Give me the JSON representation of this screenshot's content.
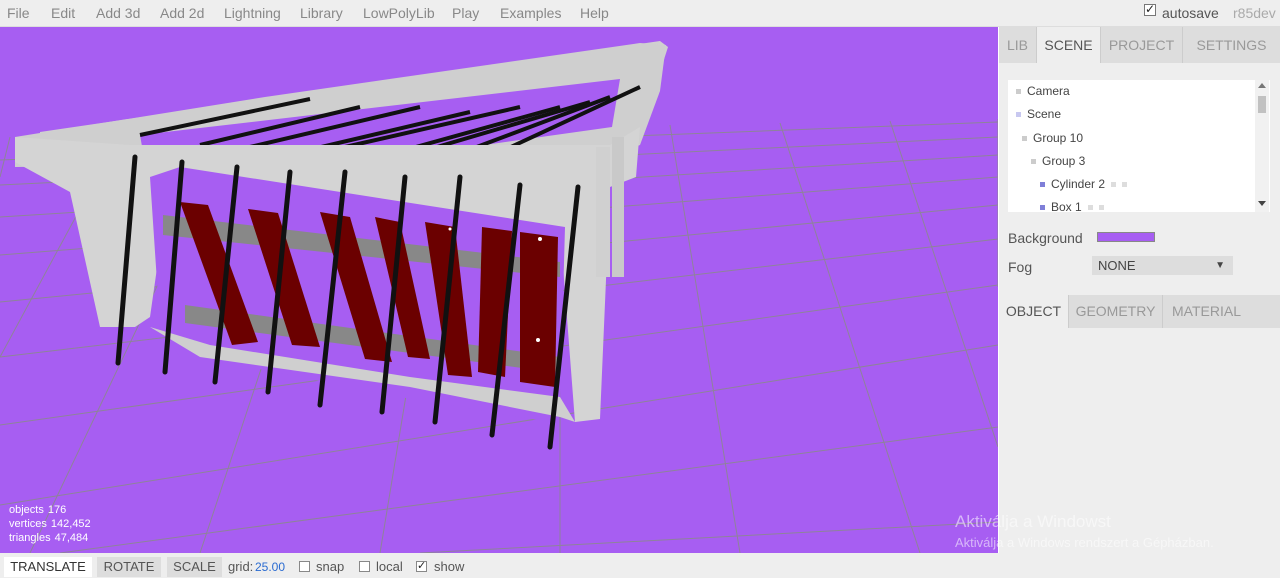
{
  "menubar": {
    "items": [
      "File",
      "Edit",
      "Add 3d",
      "Add 2d",
      "Lightning",
      "Library",
      "LowPolyLib",
      "Play",
      "Examples",
      "Help"
    ],
    "autosave_label": "autosave",
    "autosave_checked": true,
    "user": "r85dev"
  },
  "viewport": {
    "background_color": "#a75ef2",
    "info": {
      "objects_label": "objects",
      "objects_value": "176",
      "vertices_label": "vertices",
      "vertices_value": "142,452",
      "triangles_label": "triangles",
      "triangles_value": "47,484"
    }
  },
  "sidebar": {
    "tabs": [
      "LIB",
      "SCENE",
      "PROJECT",
      "SETTINGS"
    ],
    "active_tab": "SCENE",
    "outliner": [
      "Camera",
      "Scene",
      "Group 10",
      "Group 3",
      "Cylinder 2",
      "Box 1"
    ],
    "background_label": "Background",
    "background_color": "#a75ef2",
    "fog_label": "Fog",
    "fog_value": "NONE",
    "object_tabs": [
      "OBJECT",
      "GEOMETRY",
      "MATERIAL"
    ],
    "active_object_tab": "OBJECT"
  },
  "watermark": {
    "line1": "Aktiválja a Windowst",
    "line2": "Aktiválja a Windows rendszert a Gépházban."
  },
  "toolbar": {
    "translate": "TRANSLATE",
    "rotate": "ROTATE",
    "scale": "SCALE",
    "grid_label": "grid:",
    "grid_value": "25.00",
    "snap_label": "snap",
    "local_label": "local",
    "show_label": "show",
    "show_checked": true
  }
}
